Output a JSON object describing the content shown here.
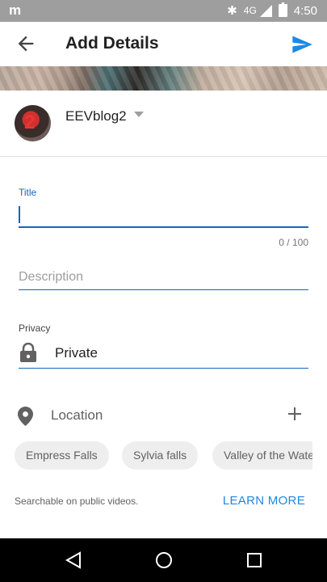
{
  "status_bar": {
    "app_icon": "m",
    "bluetooth_icon": "bluetooth-icon",
    "network": "4G",
    "time": "4:50"
  },
  "toolbar": {
    "back_icon": "arrow-back-icon",
    "title": "Add Details",
    "send_icon": "send-icon"
  },
  "account": {
    "name": "EEVblog2",
    "avatar_mark": "2"
  },
  "form": {
    "title_label": "Title",
    "title_value": "",
    "char_count": "0 / 100",
    "description_placeholder": "Description",
    "privacy_label": "Privacy",
    "privacy_value": "Private"
  },
  "location": {
    "label": "Location",
    "suggestions": [
      "Empress Falls",
      "Sylvia falls",
      "Valley of the Waters"
    ]
  },
  "footer": {
    "searchable_text": "Searchable on public videos.",
    "learn_more": "LEARN MORE"
  },
  "colors": {
    "accent": "#1565c0",
    "link": "#1e88e5",
    "status_bar": "#9e9e9e",
    "nav_bar": "#000000"
  }
}
